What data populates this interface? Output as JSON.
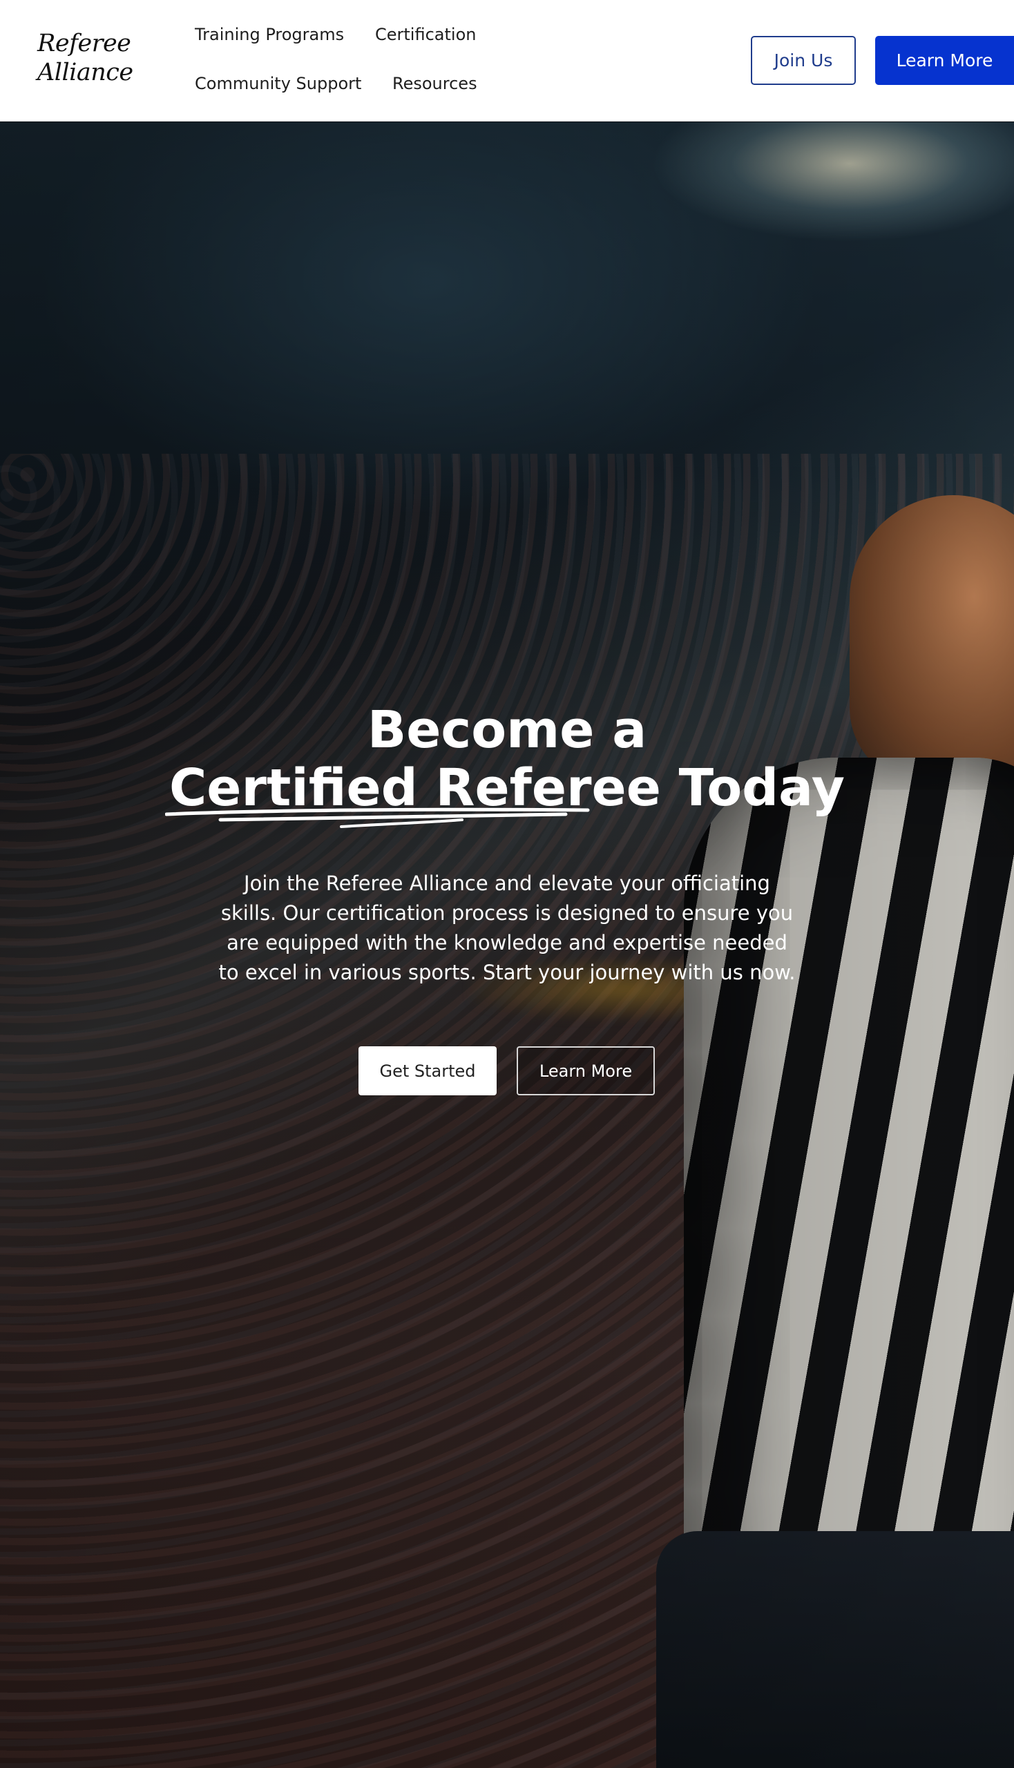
{
  "header": {
    "logo_line1": "Referee",
    "logo_line2": "Alliance",
    "nav": {
      "training": "Training Programs",
      "certification": "Certification",
      "community": "Community Support",
      "resources": "Resources"
    },
    "join_label": "Join Us",
    "learn_label": "Learn More"
  },
  "hero": {
    "title_line1": "Become a",
    "title_highlight": "Certified Referee",
    "title_end": "Today",
    "description": "Join the Referee Alliance and elevate your officiating skills. Our certification process is designed to ensure you are equipped with the knowledge and expertise needed to excel in various sports. Start your journey with us now.",
    "primary_label": "Get Started",
    "secondary_label": "Learn More"
  },
  "colors": {
    "accent": "#0633cf",
    "outline": "#1f3c8c",
    "hero_text": "#ffffff"
  }
}
